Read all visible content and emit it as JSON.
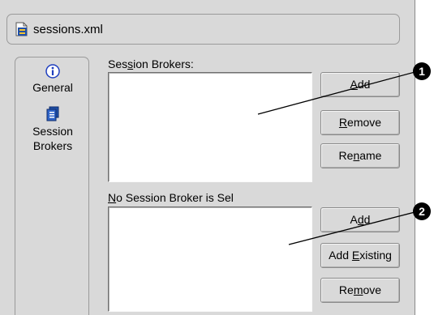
{
  "header": {
    "filename": "sessions.xml",
    "file_icon": "xml-file-icon"
  },
  "nav": {
    "items": [
      {
        "label": "General",
        "icon": "info-icon"
      },
      {
        "label_line1": "Session",
        "label_line2": "Brokers",
        "icon": "session-brokers-icon"
      }
    ]
  },
  "brokers": {
    "label_prefix": "Ses",
    "label_mnemonic": "s",
    "label_suffix": "ion Brokers:",
    "add_prefix": "",
    "add_mnemonic": "A",
    "add_suffix": "dd",
    "remove_prefix": "",
    "remove_mnemonic": "R",
    "remove_suffix": "emove",
    "rename_prefix": "Re",
    "rename_mnemonic": "n",
    "rename_suffix": "ame"
  },
  "sessions": {
    "label_prefix": "",
    "label_mnemonic": "N",
    "label_suffix": "o Session Broker is Sel",
    "add_prefix": "A",
    "add_mnemonic": "d",
    "add_suffix": "d",
    "add_existing_prefix": "Add ",
    "add_existing_mnemonic": "E",
    "add_existing_suffix": "xisting",
    "remove_prefix": "Re",
    "remove_mnemonic": "m",
    "remove_suffix": "ove"
  },
  "callouts": [
    {
      "number": "1"
    },
    {
      "number": "2"
    }
  ],
  "colors": {
    "panel": "#d9d9d9",
    "border": "#9a9a9a",
    "list_bg": "#ffffff",
    "callout": "#000000"
  }
}
